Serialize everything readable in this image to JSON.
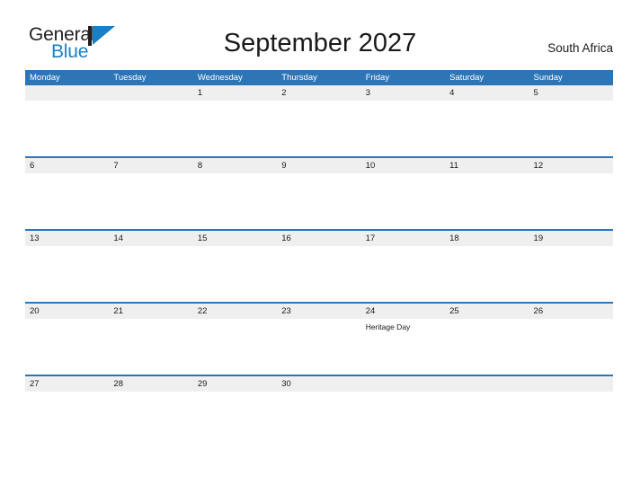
{
  "brand": {
    "name_part1": "General",
    "name_part2": "Blue",
    "color_dark": "#231f20",
    "color_blue": "#1b7fc4",
    "flag_icon": "blue-flag-triangle-icon"
  },
  "header": {
    "title": "September 2027",
    "country": "South Africa"
  },
  "theme": {
    "header_blue": "#2e75b6",
    "date_band_gray": "#efefef",
    "text_dark": "#1a1a1a",
    "page_background": "#ffffff"
  },
  "calendar": {
    "month": "September",
    "year": "2027",
    "week_start": "Monday",
    "weekdays": [
      "Monday",
      "Tuesday",
      "Wednesday",
      "Thursday",
      "Friday",
      "Saturday",
      "Sunday"
    ],
    "weeks": [
      {
        "days": [
          {
            "date": "",
            "event": ""
          },
          {
            "date": "",
            "event": ""
          },
          {
            "date": "1",
            "event": ""
          },
          {
            "date": "2",
            "event": ""
          },
          {
            "date": "3",
            "event": ""
          },
          {
            "date": "4",
            "event": ""
          },
          {
            "date": "5",
            "event": ""
          }
        ]
      },
      {
        "days": [
          {
            "date": "6",
            "event": ""
          },
          {
            "date": "7",
            "event": ""
          },
          {
            "date": "8",
            "event": ""
          },
          {
            "date": "9",
            "event": ""
          },
          {
            "date": "10",
            "event": ""
          },
          {
            "date": "11",
            "event": ""
          },
          {
            "date": "12",
            "event": ""
          }
        ]
      },
      {
        "days": [
          {
            "date": "13",
            "event": ""
          },
          {
            "date": "14",
            "event": ""
          },
          {
            "date": "15",
            "event": ""
          },
          {
            "date": "16",
            "event": ""
          },
          {
            "date": "17",
            "event": ""
          },
          {
            "date": "18",
            "event": ""
          },
          {
            "date": "19",
            "event": ""
          }
        ]
      },
      {
        "days": [
          {
            "date": "20",
            "event": ""
          },
          {
            "date": "21",
            "event": ""
          },
          {
            "date": "22",
            "event": ""
          },
          {
            "date": "23",
            "event": ""
          },
          {
            "date": "24",
            "event": "Heritage Day"
          },
          {
            "date": "25",
            "event": ""
          },
          {
            "date": "26",
            "event": ""
          }
        ]
      },
      {
        "days": [
          {
            "date": "27",
            "event": ""
          },
          {
            "date": "28",
            "event": ""
          },
          {
            "date": "29",
            "event": ""
          },
          {
            "date": "30",
            "event": ""
          },
          {
            "date": "",
            "event": ""
          },
          {
            "date": "",
            "event": ""
          },
          {
            "date": "",
            "event": ""
          }
        ]
      }
    ]
  }
}
